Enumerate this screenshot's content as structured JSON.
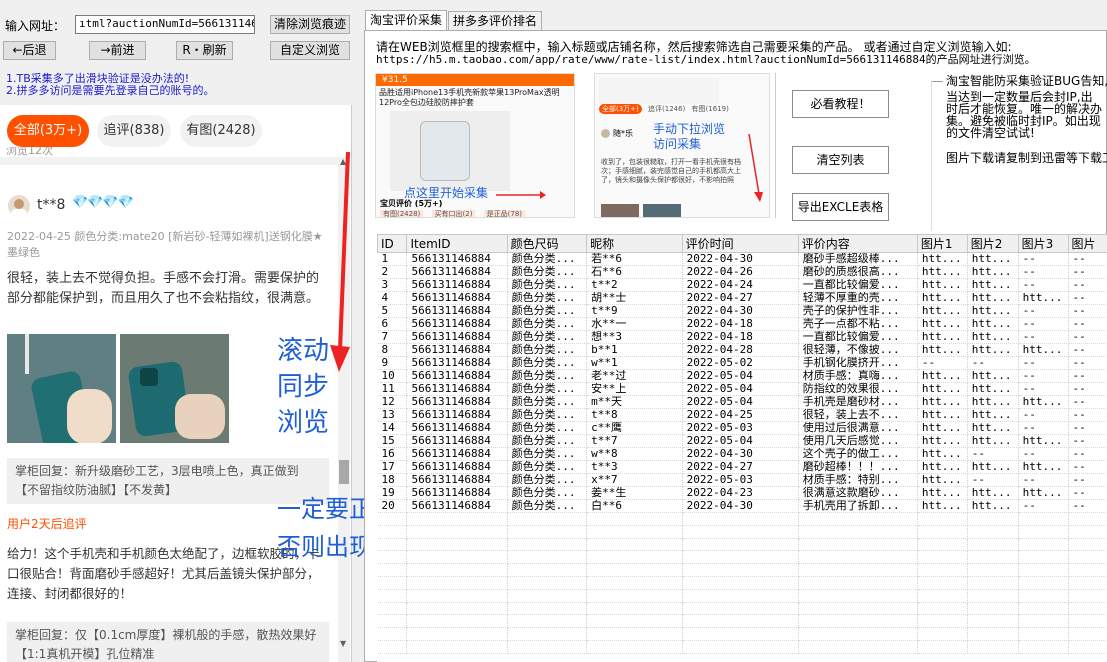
{
  "browser": {
    "url_label": "输入网址：",
    "url_value": "ıtml?auctionNumId=566131146884",
    "clear_label": "清除浏览痕迹",
    "back_label": "←后退",
    "forward_label": "→前进",
    "refresh_label": "R・刷新",
    "custom_label": "自定义浏览"
  },
  "notices": [
    "1.TB采集多了出滑块验证是没办法的!",
    "2.拼多多访问是需要先登录自己的账号的。"
  ],
  "webview": {
    "filters": [
      "全部(3万+)",
      "追评(838)",
      "有图(2428)"
    ],
    "viewed_text": "浏览12次",
    "reviewer": "t**8",
    "badge_icons": "💎💎💎💎",
    "review_meta": "2022-04-25 颜色分类:mate20 [新岩砂-轻薄如裸机]送钢化膜★墨绿色",
    "review_text": "很轻，装上去不觉得负担。手感不会打滑。需要保护的部分都能保护到，而且用久了也不会粘指纹，很满意。",
    "reply_1": "掌柜回复：新升级磨砂工艺，3层电喷上色，真正做到【不留指纹防油腻】【不发黄】",
    "followup_label": "用户2天后追评",
    "followup_text": "给力！这个手机壳和手机颜色太绝配了，边框软胶的，卡口很贴合！背面磨砂手感超好！尤其后盖镜头保护部分，连接、封闭都很好的！",
    "reply_2": "掌柜回复：仅【0.1cm厚度】裸机般的手感，散热效果好【1:1真机开模】孔位精准"
  },
  "overlay": {
    "scroll_sync": [
      "滚动",
      "同步",
      "浏览"
    ],
    "warning_1": "一定要正常。",
    "warning_2": "否则出现滑块验证码就GG了。。。"
  },
  "tabs": [
    "淘宝评价采集",
    "拼多多评价排名"
  ],
  "instructions": [
    "请在WEB浏览框里的搜索框中，输入标题或店铺名称，然后搜索筛选自己需要采集的产品。 或者通过自定义浏览输入如:",
    "https://h5.m.taobao.com/app/rate/www/rate-list/index.html?auctionNumId=566131146884的产品网址进行浏览。"
  ],
  "thumbs": {
    "t1_price": "¥31.5",
    "t1_title": "品胜适用iPhone13手机壳新款苹果13ProMax透明12Pro全包边硅胶防摔护套",
    "t1_annot": "点这里开始采集",
    "t1_row": "宝贝评价 (5万+)",
    "t1_chips": [
      "有图(2428)",
      "买有口出(2)",
      "是正品(78)"
    ],
    "t2_filters": [
      "全部(3万+)",
      "追评(1246)",
      "有图(1619)"
    ],
    "t2_user": "随*乐",
    "t2_annot_1": "手动下拉浏览",
    "t2_annot_2": "访问采集",
    "t2_text": "收到了，包装很糙取，打开一看手机壳很有档次；手感细腻，装完感觉自己的手机都高大上了，镜头和摄像头保护都很好，不影响拍照"
  },
  "actions": {
    "tutorial": "必看教程！",
    "clear_list": "清空列表",
    "export": "导出EXCLE表格"
  },
  "side_notice": [
    "淘宝智能防采集验证BUG告知,被",
    "当达到一定数量后会封IP,出",
    "时后才能恢复。唯一的解决办",
    "集。避免被临时封IP。如出现",
    "的文件清空试试!",
    "",
    "图片下载请复制到迅雷等下载工"
  ],
  "table": {
    "columns": [
      "ID",
      "ItemID",
      "颜色尺码",
      "昵称",
      "评价时间",
      "评价内容",
      "图片1",
      "图片2",
      "图片3",
      "图片"
    ],
    "rows": [
      [
        "1",
        "566131146884",
        "颜色分类...",
        "若**6",
        "2022-04-30",
        "磨砂手感超级棒...",
        "htt...",
        "htt...",
        "--",
        "--"
      ],
      [
        "2",
        "566131146884",
        "颜色分类...",
        "石**6",
        "2022-04-26",
        "磨砂的质感很高...",
        "htt...",
        "htt...",
        "--",
        "--"
      ],
      [
        "3",
        "566131146884",
        "颜色分类...",
        "t**2",
        "2022-04-24",
        "一直都比较偏爱...",
        "htt...",
        "htt...",
        "--",
        "--"
      ],
      [
        "4",
        "566131146884",
        "颜色分类...",
        "胡**士",
        "2022-04-27",
        "轻薄不厚重的壳...",
        "htt...",
        "htt...",
        "htt...",
        "--"
      ],
      [
        "5",
        "566131146884",
        "颜色分类...",
        "t**9",
        "2022-04-30",
        "壳子的保护性非...",
        "htt...",
        "htt...",
        "--",
        "--"
      ],
      [
        "6",
        "566131146884",
        "颜色分类...",
        "水**一",
        "2022-04-18",
        "壳子一点都不粘...",
        "htt...",
        "htt...",
        "--",
        "--"
      ],
      [
        "7",
        "566131146884",
        "颜色分类...",
        "想**3",
        "2022-04-18",
        "一直都比较偏爱...",
        "htt...",
        "htt...",
        "--",
        "--"
      ],
      [
        "8",
        "566131146884",
        "颜色分类...",
        "b**1",
        "2022-04-28",
        "很轻薄，不像披...",
        "htt...",
        "htt...",
        "htt...",
        "--"
      ],
      [
        "9",
        "566131146884",
        "颜色分类...",
        "w**1",
        "2022-05-02",
        "手机钢化膜挤开...",
        "--",
        "--",
        "--",
        "--"
      ],
      [
        "10",
        "566131146884",
        "颜色分类...",
        "老**过",
        "2022-05-04",
        "材质手感：真嗨...",
        "htt...",
        "htt...",
        "--",
        "--"
      ],
      [
        "11",
        "566131146884",
        "颜色分类...",
        "安**上",
        "2022-05-04",
        "防指纹的效果很...",
        "htt...",
        "htt...",
        "--",
        "--"
      ],
      [
        "12",
        "566131146884",
        "颜色分类...",
        "m**天",
        "2022-05-04",
        "手机壳是磨砂材...",
        "htt...",
        "htt...",
        "htt...",
        "--"
      ],
      [
        "13",
        "566131146884",
        "颜色分类...",
        "t**8",
        "2022-04-25",
        "很轻，装上去不...",
        "htt...",
        "htt...",
        "--",
        "--"
      ],
      [
        "14",
        "566131146884",
        "颜色分类...",
        "c**鹰",
        "2022-05-03",
        "使用过后很满意...",
        "htt...",
        "htt...",
        "--",
        "--"
      ],
      [
        "15",
        "566131146884",
        "颜色分类...",
        "t**7",
        "2022-05-04",
        "使用几天后感觉...",
        "htt...",
        "htt...",
        "htt...",
        "--"
      ],
      [
        "16",
        "566131146884",
        "颜色分类...",
        "w**8",
        "2022-04-30",
        "这个壳子的做工...",
        "htt...",
        "--",
        "--",
        "--"
      ],
      [
        "17",
        "566131146884",
        "颜色分类...",
        "t**3",
        "2022-04-27",
        "磨砂超棒！！！...",
        "htt...",
        "htt...",
        "htt...",
        "--"
      ],
      [
        "18",
        "566131146884",
        "颜色分类...",
        "x**7",
        "2022-05-03",
        "材质手感：特别...",
        "htt...",
        "--",
        "--",
        "--"
      ],
      [
        "19",
        "566131146884",
        "颜色分类...",
        "姜**生",
        "2022-04-23",
        "很满意这款磨砂...",
        "htt...",
        "htt...",
        "htt...",
        "--"
      ],
      [
        "20",
        "566131146884",
        "颜色分类...",
        "白**6",
        "2022-04-30",
        "手机壳用了拆卸...",
        "htt...",
        "htt...",
        "--",
        "--"
      ]
    ]
  },
  "colors": {
    "accent_orange": "#ff5000",
    "overlay_blue": "#1e5fd6",
    "notice_blue": "#1a1ad0",
    "arrow_red": "#ee2222"
  }
}
